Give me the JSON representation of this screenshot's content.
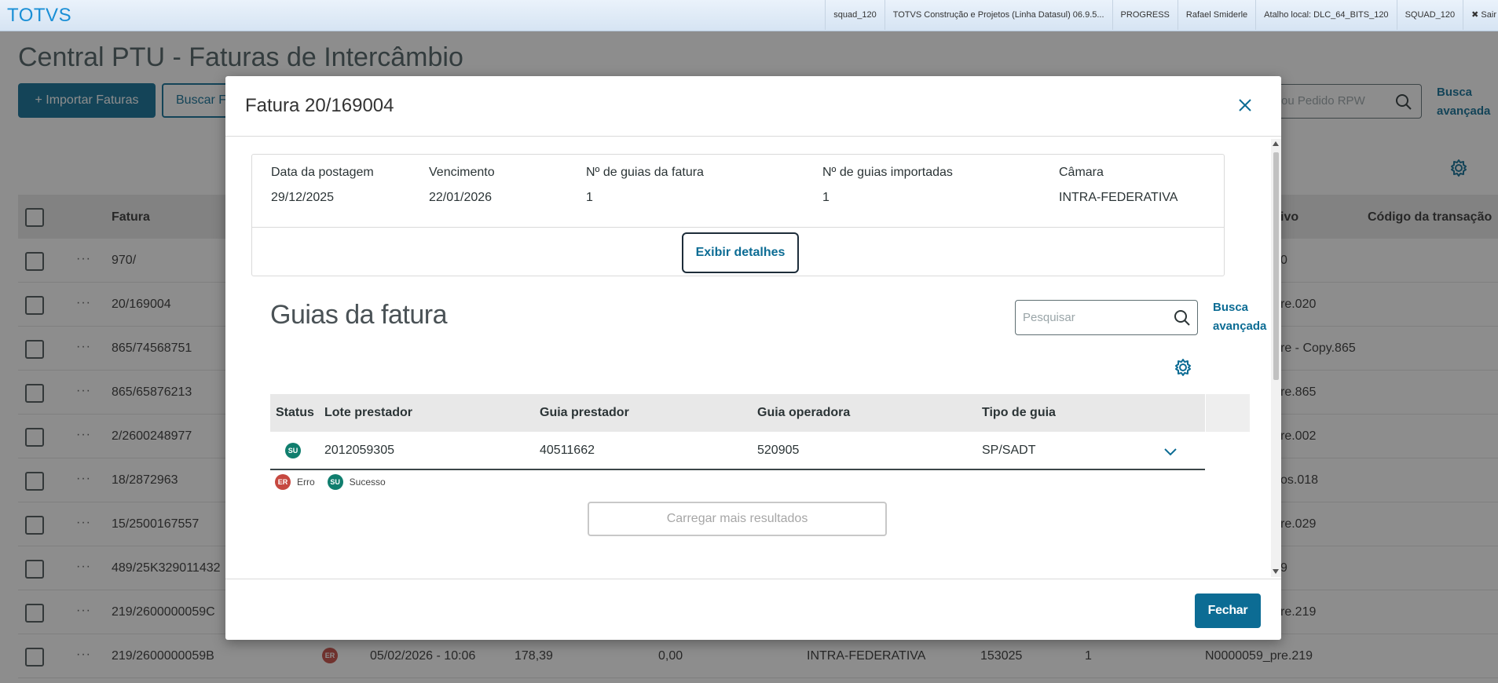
{
  "topbar": {
    "brand": "TOTVS",
    "tabs": [
      "squad_120",
      "TOTVS Construção e Projetos (Linha Datasul) 06.9.5...",
      "PROGRESS",
      "Rafael Smiderle",
      "Atalho local: DLC_64_BITS_120",
      "SQUAD_120",
      "✖ Sair"
    ]
  },
  "page": {
    "title": "Central PTU - Faturas de Intercâmbio",
    "import_button": "+ Importar Faturas",
    "search_button": "Buscar F",
    "search_placeholder": "ou Pedido RPW",
    "advanced_search": "Busca avançada",
    "columns": [
      "Fatura",
      "ivo",
      "Código da transação"
    ],
    "rows": [
      {
        "fatura": "970/",
        "extra": "0"
      },
      {
        "fatura": "20/169004",
        "extra": "re.020"
      },
      {
        "fatura": "865/74568751",
        "extra": "re - Copy.865"
      },
      {
        "fatura": "865/65876213",
        "extra": "re.865"
      },
      {
        "fatura": "2/2600248977",
        "extra": "re.002"
      },
      {
        "fatura": "18/2872963",
        "extra": "os.018"
      },
      {
        "fatura": "15/2500167557",
        "extra": "re.029"
      },
      {
        "fatura": "489/25K329011432",
        "extra": "9"
      },
      {
        "fatura": "219/2600000059C",
        "extra": "re.219"
      }
    ],
    "last_row": {
      "fatura": "219/2600000059B",
      "status": "ER",
      "date": "05/02/2026 - 10:06",
      "value1": "178,39",
      "value2": "0,00",
      "camara": "INTRA-FEDERATIVA",
      "code": "153025",
      "count": "1",
      "file": "N0000059_pre.219"
    }
  },
  "modal": {
    "title": "Fatura 20/169004",
    "info": [
      {
        "label": "Data da postagem",
        "value": "29/12/2025"
      },
      {
        "label": "Vencimento",
        "value": "22/01/2026"
      },
      {
        "label": "Nº de guias da fatura",
        "value": "1"
      },
      {
        "label": "Nº de guias importadas",
        "value": "1"
      },
      {
        "label": "Câmara",
        "value": "INTRA-FEDERATIVA"
      }
    ],
    "details_button": "Exibir detalhes",
    "section_title": "Guias da fatura",
    "search_placeholder": "Pesquisar",
    "advanced_search_line1": "Busca",
    "advanced_search_line2": "avançada",
    "table": {
      "headers": [
        "Status",
        "Lote prestador",
        "Guia prestador",
        "Guia operadora",
        "Tipo de guia"
      ],
      "rows": [
        {
          "status": "SU",
          "lote": "2012059305",
          "guia_prestador": "40511662",
          "guia_operadora": "520905",
          "tipo": "SP/SADT"
        }
      ]
    },
    "legend": [
      {
        "badge": "ER",
        "label": "Erro"
      },
      {
        "badge": "SU",
        "label": "Sucesso"
      }
    ],
    "load_more": "Carregar mais resultados",
    "close_button": "Fechar"
  },
  "colors": {
    "primary": "#0c6c94",
    "success": "#107e6e",
    "error": "#c64840",
    "brand": "#1a8fd6"
  }
}
